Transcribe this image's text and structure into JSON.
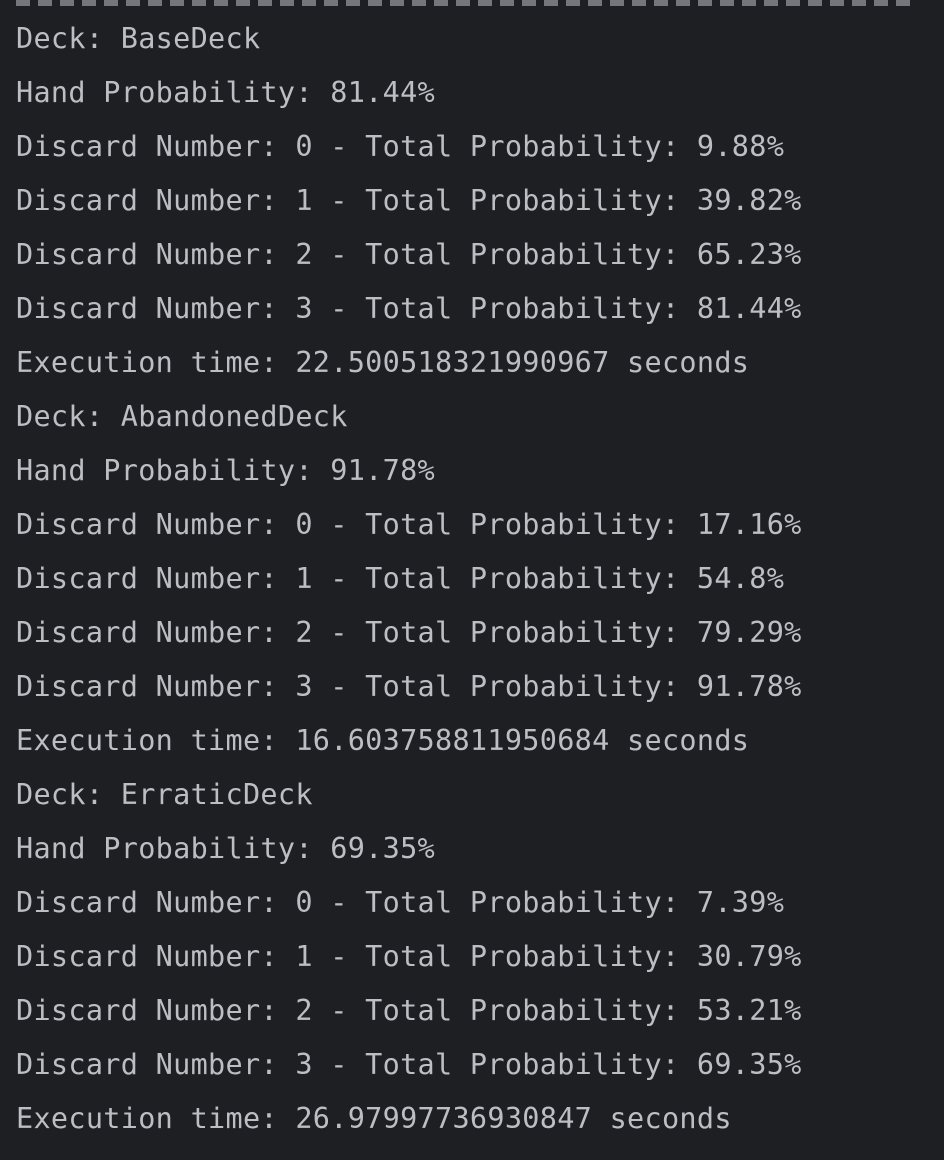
{
  "console": {
    "lines": [
      "Deck: BaseDeck",
      "Hand Probability: 81.44%",
      "Discard Number: 0 - Total Probability: 9.88%",
      "Discard Number: 1 - Total Probability: 39.82%",
      "Discard Number: 2 - Total Probability: 65.23%",
      "Discard Number: 3 - Total Probability: 81.44%",
      "Execution time: 22.500518321990967 seconds",
      "Deck: AbandonedDeck",
      "Hand Probability: 91.78%",
      "Discard Number: 0 - Total Probability: 17.16%",
      "Discard Number: 1 - Total Probability: 54.8%",
      "Discard Number: 2 - Total Probability: 79.29%",
      "Discard Number: 3 - Total Probability: 91.78%",
      "Execution time: 16.603758811950684 seconds",
      "Deck: ErraticDeck",
      "Hand Probability: 69.35%",
      "Discard Number: 0 - Total Probability: 7.39%",
      "Discard Number: 1 - Total Probability: 30.79%",
      "Discard Number: 2 - Total Probability: 53.21%",
      "Discard Number: 3 - Total Probability: 69.35%",
      "Execution time: 26.97997736930847 seconds"
    ]
  },
  "colors": {
    "background": "#1e1f22",
    "text": "#bcbec4"
  }
}
